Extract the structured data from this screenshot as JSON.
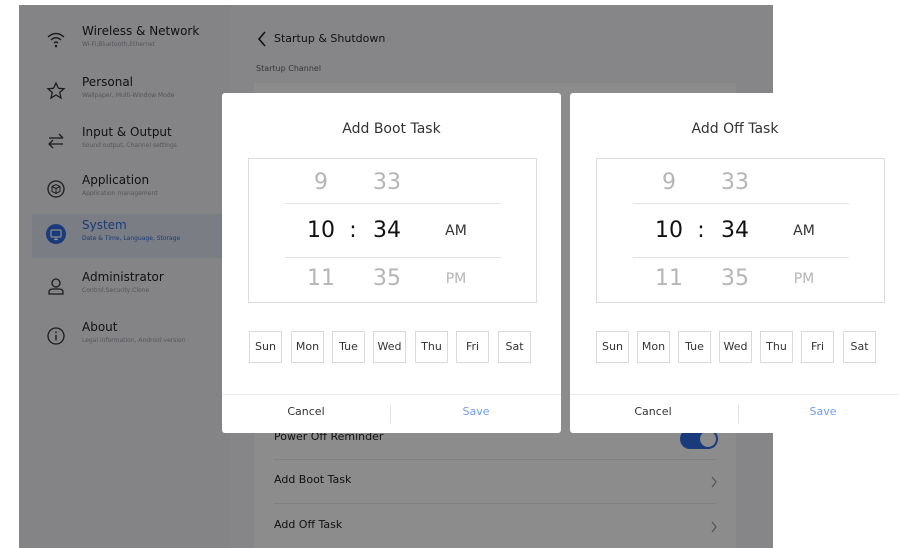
{
  "sidebar": {
    "items": [
      {
        "title": "Wireless & Network",
        "subtitle": "Wi-Fi,Bluetooth,Ethernet",
        "icon": "wifi-icon"
      },
      {
        "title": "Personal",
        "subtitle": "Wallpaper, Multi-Window Mode",
        "icon": "star-icon"
      },
      {
        "title": "Input & Output",
        "subtitle": "Sound output, Channel settings",
        "icon": "swap-arrows-icon"
      },
      {
        "title": "Application",
        "subtitle": "Application management",
        "icon": "cube-icon"
      },
      {
        "title": "System",
        "subtitle": "Date & Time, Language, Storage",
        "icon": "monitor-icon"
      },
      {
        "title": "Administrator",
        "subtitle": "Control,Security,Clone",
        "icon": "user-icon"
      },
      {
        "title": "About",
        "subtitle": "Legal information, Android version",
        "icon": "info-icon"
      }
    ]
  },
  "content": {
    "title": "Startup & Shutdown",
    "section_label": "Startup Channel",
    "rows": {
      "power_off_reminder": "Power Off Reminder",
      "add_boot_task": "Add Boot Task",
      "add_off_task": "Add Off Task"
    }
  },
  "dialogs": {
    "boot": {
      "title": "Add Boot Task",
      "hour_prev": "9",
      "hour": "10",
      "hour_next": "11",
      "minute_prev": "33",
      "minute": "34",
      "minute_next": "35",
      "separator": ":",
      "am": "AM",
      "pm": "PM",
      "cancel": "Cancel",
      "save": "Save"
    },
    "off": {
      "title": "Add Off Task",
      "hour_prev": "9",
      "hour": "10",
      "hour_next": "11",
      "minute_prev": "33",
      "minute": "34",
      "minute_next": "35",
      "separator": ":",
      "am": "AM",
      "pm": "PM",
      "cancel": "Cancel",
      "save": "Save"
    },
    "days": [
      "Sun",
      "Mon",
      "Tue",
      "Wed",
      "Thu",
      "Fri",
      "Sat"
    ]
  },
  "colors": {
    "accent": "#2f6be0",
    "save_text": "#6e9ef0"
  }
}
